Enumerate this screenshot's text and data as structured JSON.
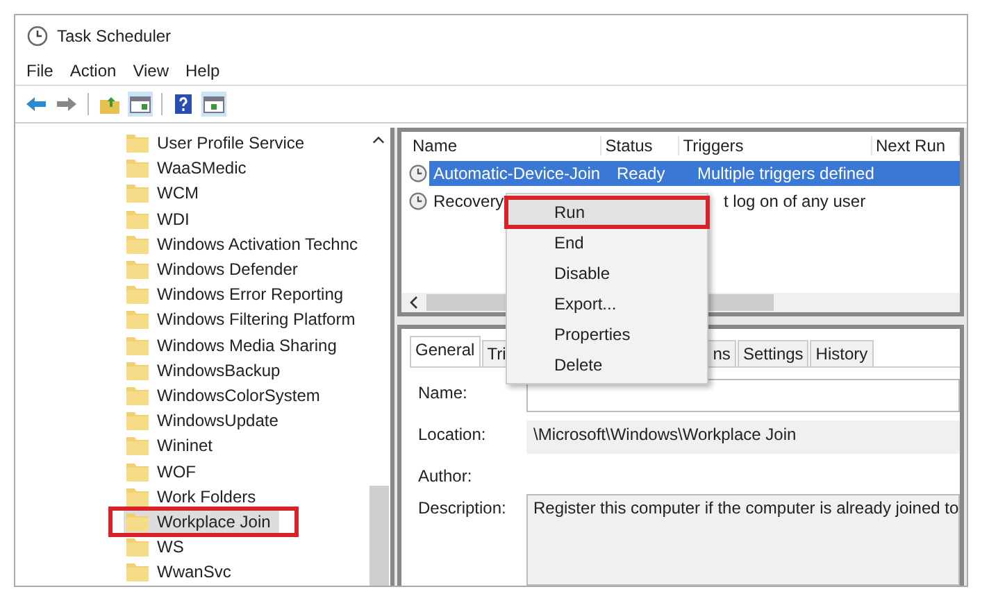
{
  "window": {
    "title": "Task Scheduler"
  },
  "menu": [
    "File",
    "Action",
    "View",
    "Help"
  ],
  "tree": {
    "items": [
      {
        "label": "User Profile Service",
        "selected": false,
        "annotated": false
      },
      {
        "label": "WaaSMedic",
        "selected": false,
        "annotated": false
      },
      {
        "label": "WCM",
        "selected": false,
        "annotated": false
      },
      {
        "label": "WDI",
        "selected": false,
        "annotated": false
      },
      {
        "label": "Windows Activation Technc",
        "selected": false,
        "annotated": false
      },
      {
        "label": "Windows Defender",
        "selected": false,
        "annotated": false
      },
      {
        "label": "Windows Error Reporting",
        "selected": false,
        "annotated": false
      },
      {
        "label": "Windows Filtering Platform",
        "selected": false,
        "annotated": false
      },
      {
        "label": "Windows Media Sharing",
        "selected": false,
        "annotated": false
      },
      {
        "label": "WindowsBackup",
        "selected": false,
        "annotated": false
      },
      {
        "label": "WindowsColorSystem",
        "selected": false,
        "annotated": false
      },
      {
        "label": "WindowsUpdate",
        "selected": false,
        "annotated": false
      },
      {
        "label": "Wininet",
        "selected": false,
        "annotated": false
      },
      {
        "label": "WOF",
        "selected": false,
        "annotated": false
      },
      {
        "label": "Work Folders",
        "selected": false,
        "annotated": false
      },
      {
        "label": "Workplace Join",
        "selected": true,
        "annotated": true
      },
      {
        "label": "WS",
        "selected": false,
        "annotated": false
      },
      {
        "label": "WwanSvc",
        "selected": false,
        "annotated": false
      }
    ]
  },
  "task_list": {
    "columns": [
      "Name",
      "Status",
      "Triggers",
      "Next Run"
    ],
    "rows": [
      {
        "name": "Automatic-Device-Join",
        "status": "Ready",
        "triggers": "Multiple triggers defined",
        "selected": true
      },
      {
        "name": "Recovery",
        "status": "",
        "triggers": "t log on of any user",
        "selected": false
      }
    ]
  },
  "tabs": [
    {
      "label": "General",
      "selected": true
    },
    {
      "label": "Tri",
      "selected": false
    },
    {
      "label": "ns",
      "selected": false
    },
    {
      "label": "Settings",
      "selected": false
    },
    {
      "label": "History",
      "selected": false
    }
  ],
  "details": {
    "name_label": "Name:",
    "location_label": "Location:",
    "location": "\\Microsoft\\Windows\\Workplace Join",
    "author_label": "Author:",
    "description_label": "Description:",
    "description": "Register this computer if the computer is already joined to"
  },
  "context_menu": [
    {
      "label": "Run",
      "selected": true,
      "annotated": true
    },
    {
      "label": "End",
      "selected": false,
      "annotated": false
    },
    {
      "label": "Disable",
      "selected": false,
      "annotated": false
    },
    {
      "label": "Export...",
      "selected": false,
      "annotated": false
    },
    {
      "label": "Properties",
      "selected": false,
      "annotated": false
    },
    {
      "label": "Delete",
      "selected": false,
      "annotated": false
    }
  ]
}
